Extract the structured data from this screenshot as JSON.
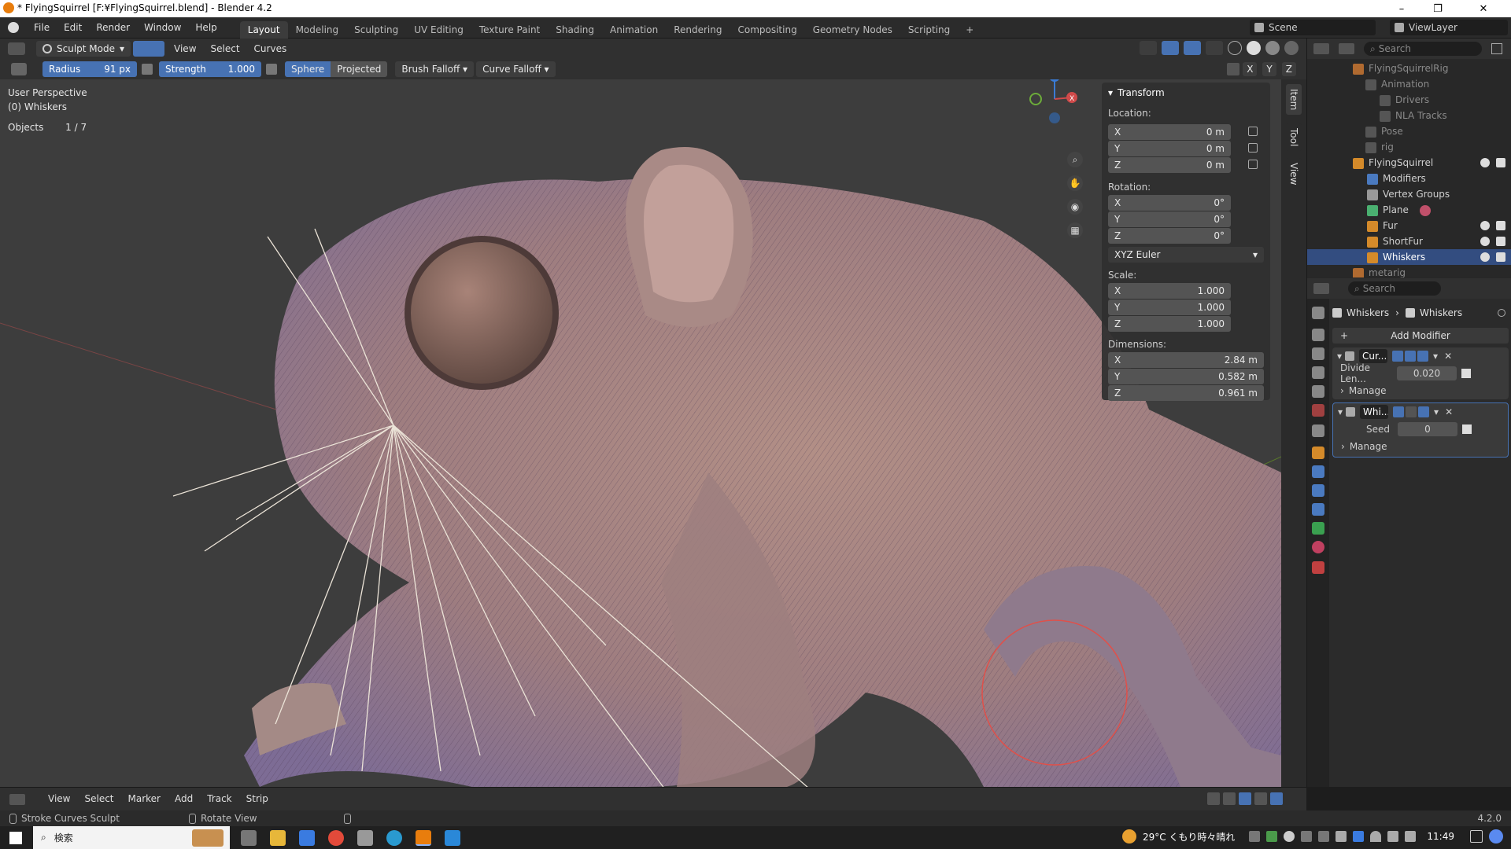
{
  "window": {
    "title": "* FlyingSquirrel [F:¥FlyingSquirrel.blend] - Blender 4.2"
  },
  "menu": [
    "File",
    "Edit",
    "Render",
    "Window",
    "Help"
  ],
  "workspaces": [
    "Layout",
    "Modeling",
    "Sculpting",
    "UV Editing",
    "Texture Paint",
    "Shading",
    "Animation",
    "Rendering",
    "Compositing",
    "Geometry Nodes",
    "Scripting"
  ],
  "topright": {
    "scene": "Scene",
    "viewlayer": "ViewLayer"
  },
  "viewport_header": {
    "mode": "Sculpt Mode",
    "menus": [
      "View",
      "Select",
      "Curves"
    ]
  },
  "tool_header": {
    "radius_label": "Radius",
    "radius_value": "91 px",
    "strength_label": "Strength",
    "strength_value": "1.000",
    "sphere": "Sphere",
    "projected": "Projected",
    "brush_falloff": "Brush Falloff",
    "curve_falloff": "Curve Falloff"
  },
  "overlay_text": {
    "perspective": "User Perspective",
    "object": "(0) Whiskers",
    "objects_label": "Objects",
    "objects_value": "1 / 7"
  },
  "axis_labels": {
    "x": "X",
    "y": "Y",
    "z": "Z",
    "xyz": [
      "X",
      "Y",
      "Z"
    ]
  },
  "npanel": {
    "title": "Transform",
    "location_label": "Location:",
    "location": [
      {
        "axis": "X",
        "value": "0 m"
      },
      {
        "axis": "Y",
        "value": "0 m"
      },
      {
        "axis": "Z",
        "value": "0 m"
      }
    ],
    "rotation_label": "Rotation:",
    "rotation": [
      {
        "axis": "X",
        "value": "0°"
      },
      {
        "axis": "Y",
        "value": "0°"
      },
      {
        "axis": "Z",
        "value": "0°"
      }
    ],
    "rotation_mode": "XYZ Euler",
    "scale_label": "Scale:",
    "scale": [
      {
        "axis": "X",
        "value": "1.000"
      },
      {
        "axis": "Y",
        "value": "1.000"
      },
      {
        "axis": "Z",
        "value": "1.000"
      }
    ],
    "dimensions_label": "Dimensions:",
    "dimensions": [
      {
        "axis": "X",
        "value": "2.84 m"
      },
      {
        "axis": "Y",
        "value": "0.582 m"
      },
      {
        "axis": "Z",
        "value": "0.961 m"
      }
    ]
  },
  "side_tabs": [
    "Item",
    "Tool",
    "View"
  ],
  "outliner": {
    "search_placeholder": "Search",
    "rows": [
      {
        "label": "FlyingSquirrelRig",
        "dim": true
      },
      {
        "label": "Animation",
        "dim": true
      },
      {
        "label": "Drivers",
        "dim": true
      },
      {
        "label": "NLA Tracks",
        "dim": true
      },
      {
        "label": "Pose",
        "dim": true
      },
      {
        "label": "rig",
        "dim": true
      },
      {
        "label": "FlyingSquirrel",
        "dim": false
      },
      {
        "label": "Modifiers",
        "dim": false
      },
      {
        "label": "Vertex Groups",
        "dim": false
      },
      {
        "label": "Plane",
        "dim": false
      },
      {
        "label": "Fur",
        "dim": false
      },
      {
        "label": "ShortFur",
        "dim": false
      },
      {
        "label": "Whiskers",
        "dim": false,
        "selected": true
      },
      {
        "label": "metarig",
        "dim": true
      }
    ]
  },
  "properties": {
    "search_placeholder": "Search",
    "breadcrumb": [
      "Whiskers",
      "Whiskers"
    ],
    "add_modifier": "Add Modifier",
    "modifiers": [
      {
        "name": "Cur...",
        "field_label": "Divide Len...",
        "field_value": "0.020",
        "manage": "Manage"
      },
      {
        "name": "Whi...",
        "field_label": "Seed",
        "field_value": "0",
        "manage": "Manage"
      }
    ]
  },
  "timeline": {
    "menus": [
      "View",
      "Select",
      "Marker",
      "Add",
      "Track",
      "Strip"
    ]
  },
  "statusbar": {
    "left": "Stroke Curves Sculpt",
    "mid": "Rotate View",
    "version": "4.2.0"
  },
  "taskbar": {
    "search": "検索",
    "weather": "29°C くもり時々晴れ",
    "time": "11:49"
  },
  "colors": {
    "accent": "#4772b3",
    "selection": "#334d80",
    "fur": "#8a7aa8",
    "skin": "#b08a80"
  }
}
